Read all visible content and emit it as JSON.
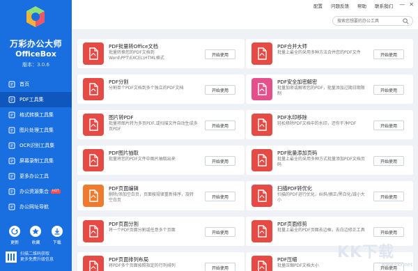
{
  "brand": {
    "name": "万彩办公大师",
    "name_en": "OfficeBox",
    "version": "版本：3.0.6"
  },
  "nav": [
    {
      "label": "首页",
      "icon": "home-icon"
    },
    {
      "label": "PDF工具集",
      "icon": "pdf-icon",
      "active": true
    },
    {
      "label": "格式转换工具集",
      "icon": "convert-icon"
    },
    {
      "label": "图片处理工具集",
      "icon": "image-icon"
    },
    {
      "label": "OCR识别工具集",
      "icon": "ocr-icon"
    },
    {
      "label": "屏幕录制工具集",
      "icon": "screen-record-icon"
    },
    {
      "label": "更多办公工具",
      "icon": "more-tools-icon"
    },
    {
      "label": "办公资源集合",
      "icon": "resources-icon",
      "badge": "HOT"
    },
    {
      "label": "办公网址导航",
      "icon": "globe-icon"
    }
  ],
  "bottom": {
    "update": "更新",
    "favorite": "收藏",
    "download": "下载",
    "qr_line1": "扫描二维码获取",
    "qr_line2": "更多免费升级信息"
  },
  "topbar": {
    "links": [
      "配置",
      "问题反馈",
      "帮助",
      "联系我们"
    ],
    "search_placeholder": "搜索您想要的办公工具"
  },
  "button_label": "开始使用",
  "cards": [
    {
      "title": "PDF批量转Office文档",
      "desc": "批量转换您的PDF文档到Word\\PPT\\EXCEL\\HTML格式",
      "color": "#e54a45",
      "icon": "pdf-to-office-icon"
    },
    {
      "title": "PDF合并大师",
      "desc": "批量上最全的采用多种方法合并您的PDF文件",
      "color": "#e54a45",
      "icon": "pdf-merge-icon"
    },
    {
      "title": "PDF分割",
      "desc": "分割单个PDF文档到多个独立的PDF文档",
      "color": "#e54a45",
      "icon": "pdf-split-icon"
    },
    {
      "title": "PDF安全加密解密",
      "desc": "批量加密或解密您的PDF，批量添加过期日期限制",
      "color": "#e3508b",
      "icon": "pdf-security-icon"
    },
    {
      "title": "图片转PDF",
      "desc": "批量将图片转为多页PDF,或扫描文件自动生成多页PDF",
      "color": "#e54a45",
      "icon": "image-to-pdf-icon"
    },
    {
      "title": "PDF水印移除",
      "desc": "轻松移除PDF文档中的水印，还你干净PDF",
      "color": "#e54a45",
      "icon": "pdf-watermark-remove-icon"
    },
    {
      "title": "PDF图片抽取",
      "desc": "批量将您的PDF文件中图片抽取出来",
      "color": "#e54a45",
      "icon": "pdf-image-extract-icon"
    },
    {
      "title": "PDF批量添加页码",
      "desc": "批量上最全的采用多种方式批量添加PDF文档页码",
      "color": "#e54a45",
      "icon": "pdf-page-number-icon"
    },
    {
      "title": "PDF页面编辑",
      "desc": "删除/添加空白页，页面按规律重新排序，旋转空白页",
      "color": "#ef7b2f",
      "icon": "pdf-page-edit-icon"
    },
    {
      "title": "扫描PDF转优化",
      "desc": "扫描的PDF进行优化，纠斜/摘正/黑白化/减小大小",
      "color": "#e54a45",
      "icon": "scan-optimize-icon"
    },
    {
      "title": "PDF页面分割",
      "desc": "将一个PDF页面分割或任意多个页面",
      "color": "#e54a45",
      "icon": "pdf-page-split-icon"
    },
    {
      "title": "PDF页面修剪",
      "desc": "批量上最全的PDF页面去边框，去白边修正工具",
      "color": "#e54a45",
      "icon": "pdf-page-crop-icon"
    },
    {
      "title": "PDF页面排列布局",
      "desc": "将PDF多个页面按照指定的行列排列",
      "color": "#e54a45",
      "icon": "pdf-layout-icon"
    },
    {
      "title": "PDF压缩",
      "desc": "批量压缩PDF文档大小",
      "color": "#e54a45",
      "icon": "pdf-compress-icon"
    }
  ],
  "watermark": {
    "text": "KK下载",
    "url": "www.kkx.net"
  }
}
